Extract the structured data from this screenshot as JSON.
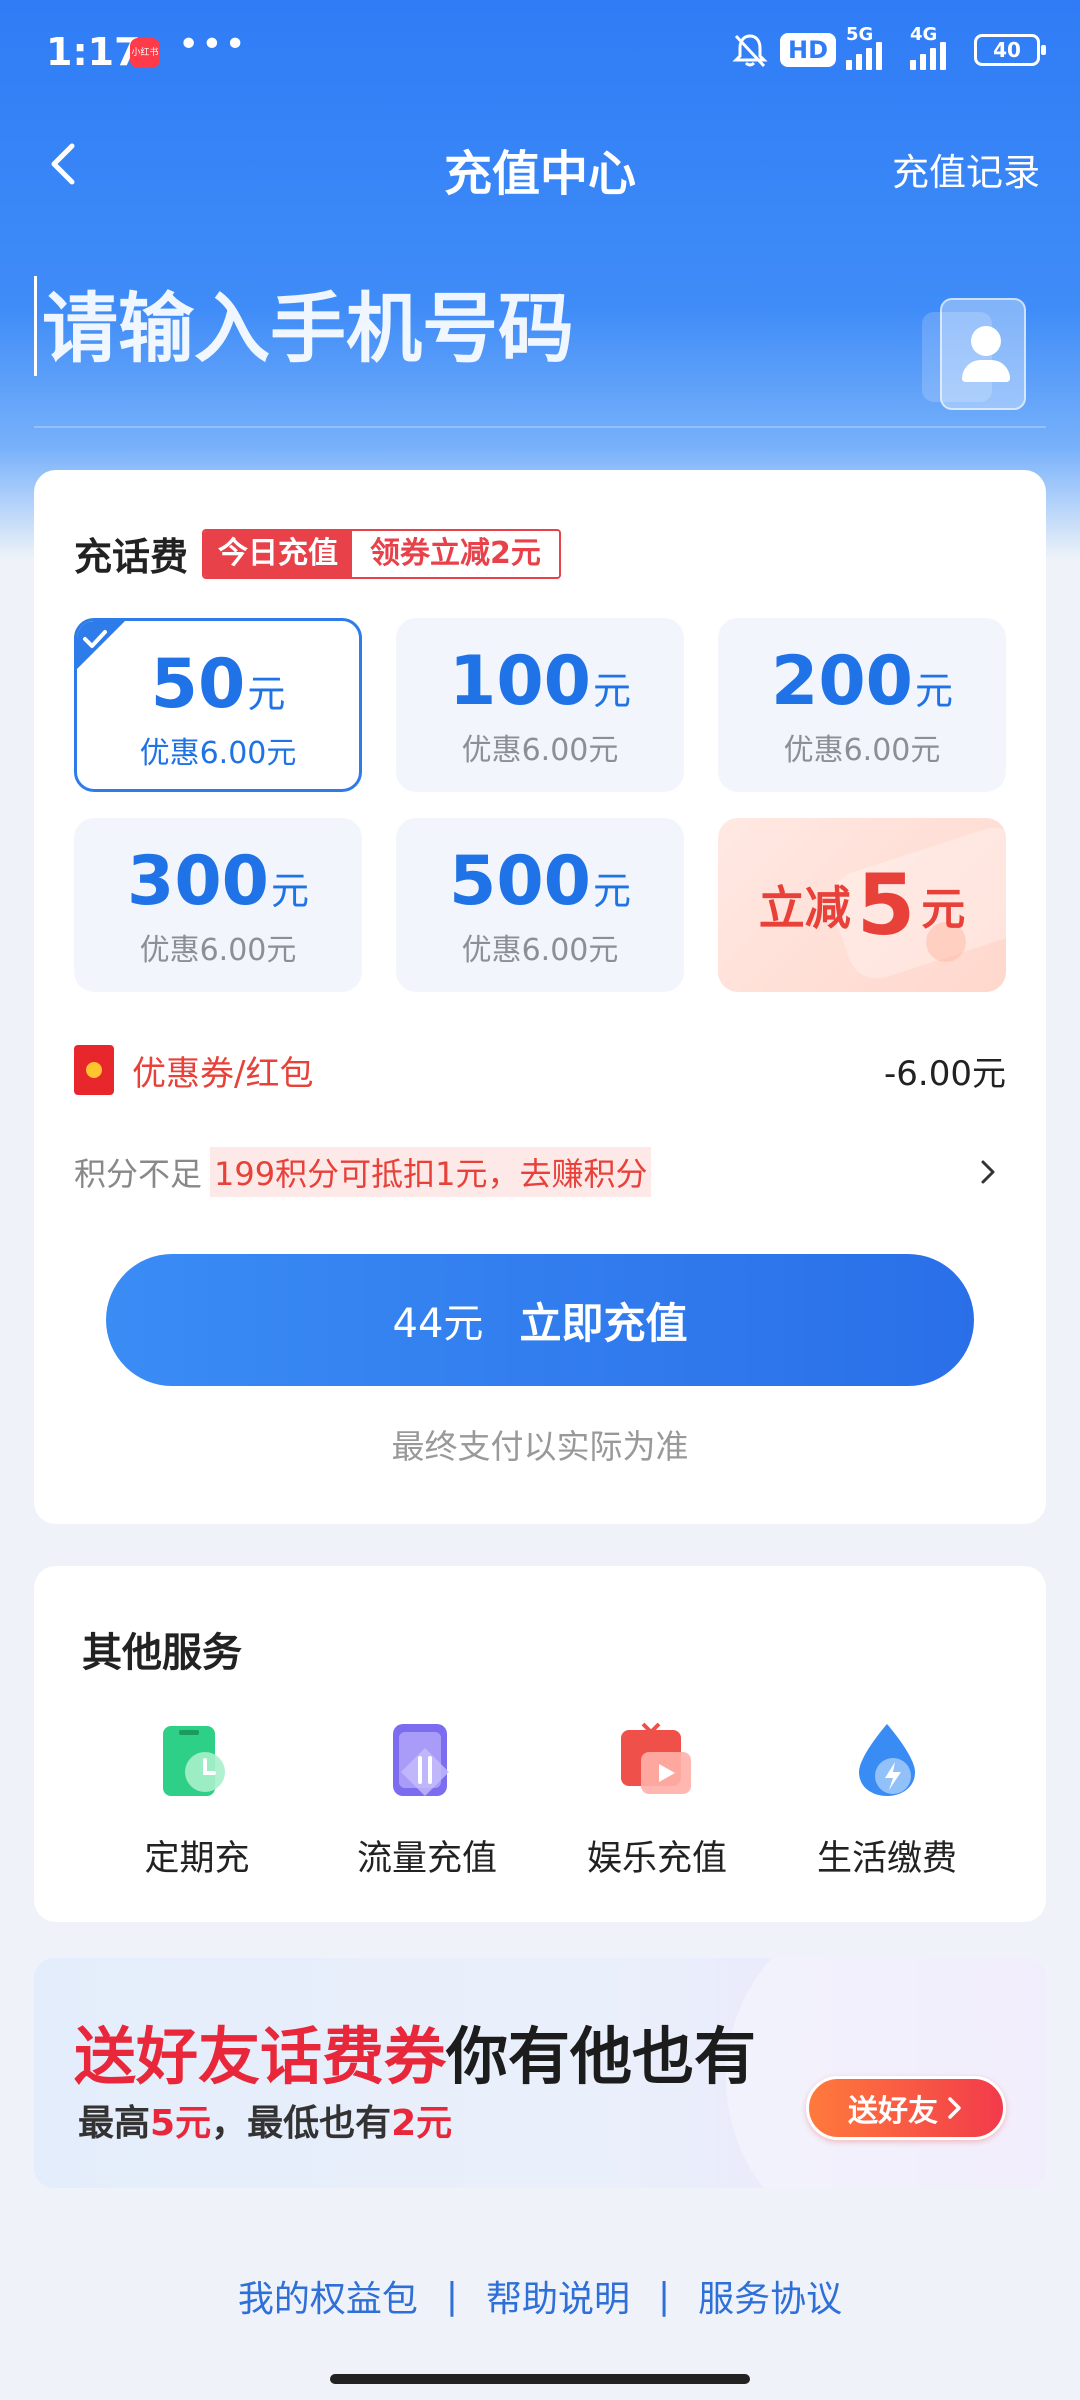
{
  "status_bar": {
    "time": "1:17",
    "app_badge": "小红书",
    "dots": "•••",
    "hd_label": "HD",
    "network_5g": "5G",
    "network_4g": "4G",
    "battery": "40"
  },
  "nav": {
    "title": "充值中心",
    "record_label": "充值记录"
  },
  "phone_input": {
    "placeholder": "请输入手机号码"
  },
  "recharge": {
    "section_title": "充话费",
    "promo_left": "今日充值",
    "promo_right": "领券立减2元",
    "options": [
      {
        "amount": "50",
        "unit": "元",
        "discount": "优惠6.00元",
        "selected": true
      },
      {
        "amount": "100",
        "unit": "元",
        "discount": "优惠6.00元",
        "selected": false
      },
      {
        "amount": "200",
        "unit": "元",
        "discount": "优惠6.00元",
        "selected": false
      },
      {
        "amount": "300",
        "unit": "元",
        "discount": "优惠6.00元",
        "selected": false
      },
      {
        "amount": "500",
        "unit": "元",
        "discount": "优惠6.00元",
        "selected": false
      }
    ],
    "special": {
      "prefix": "立减",
      "number": "5",
      "unit": "元"
    },
    "coupon_label": "优惠券/红包",
    "coupon_value": "-6.00元",
    "points_prefix": "积分不足",
    "points_highlight": "199积分可抵扣1元，去赚积分",
    "pay_amount": "44元",
    "pay_label": "立即充值",
    "pay_note": "最终支付以实际为准"
  },
  "services": {
    "title": "其他服务",
    "items": [
      {
        "label": "定期充",
        "icon": "scheduled-recharge-icon",
        "color": "#2ecf86"
      },
      {
        "label": "流量充值",
        "icon": "data-recharge-icon",
        "color": "#7c6cf0"
      },
      {
        "label": "娱乐充值",
        "icon": "entertainment-recharge-icon",
        "color": "#f0504a"
      },
      {
        "label": "生活缴费",
        "icon": "utility-payment-icon",
        "color": "#3a8cf5"
      }
    ]
  },
  "banner": {
    "title_red": "送好友话费券",
    "title_dark": "你有他也有",
    "sub_1": "最高",
    "sub_2": "5元",
    "sub_3": "，最低也有",
    "sub_4": "2元",
    "button_label": "送好友"
  },
  "footer": {
    "links": [
      "我的权益包",
      "帮助说明",
      "服务协议"
    ],
    "separator": "|"
  },
  "colors": {
    "primary": "#2e7ce9",
    "accent_red": "#e8413a",
    "page_bg": "#eff3f9"
  }
}
